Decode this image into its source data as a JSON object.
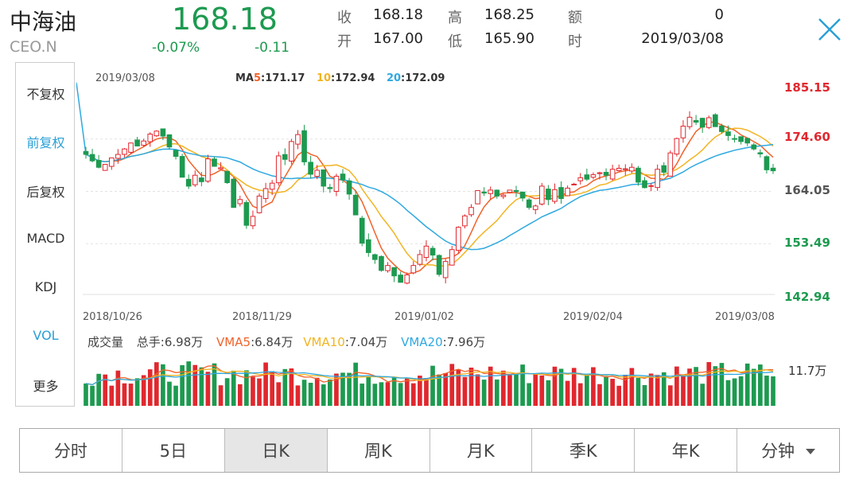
{
  "header": {
    "name": "中海油",
    "code": "CEO.N",
    "price": "168.18",
    "change_pct": "-0.07%",
    "change": "-0.11",
    "quote": [
      {
        "label": "收",
        "value": "168.18"
      },
      {
        "label": "开",
        "value": "167.00"
      },
      {
        "label": "高",
        "value": "168.25"
      },
      {
        "label": "低",
        "value": "165.90"
      },
      {
        "label": "额",
        "value": "0"
      },
      {
        "label": "时",
        "value": "2019/03/08"
      }
    ]
  },
  "left_panel": {
    "items": [
      "不复权",
      "前复权",
      "后复权",
      "MACD",
      "KDJ",
      "VOL",
      "更多"
    ]
  },
  "chart": {
    "top_date": "2019/03/08",
    "ma_label": "MA",
    "ma5_key": "5",
    "ma5_value": ":171.17",
    "ma10_key": "10",
    "ma10_value": ":172.94",
    "ma20_key": "20",
    "ma20_value": ":172.09",
    "y_labels": [
      "185.15",
      "174.60",
      "164.05",
      "153.49",
      "142.94"
    ],
    "x_labels": [
      "2018/10/26",
      "2018/11/29",
      "2019/01/02",
      "2019/02/04",
      "2019/03/08"
    ],
    "vol_title": "成交量",
    "vol_total_label": "总手:",
    "vol_total_value": "6.98万",
    "vma5_label": "VMA5",
    "vma5_value": ":6.84万",
    "vma10_label": "VMA10",
    "vma10_value": ":7.04万",
    "vma20_label": "VMA20",
    "vma20_value": ":7.96万",
    "vol_axis_label": "11.7万"
  },
  "tabs": [
    "分时",
    "5日",
    "日K",
    "周K",
    "月K",
    "季K",
    "年K",
    "分钟"
  ],
  "colors": {
    "up": "#e0282e",
    "down": "#1d9a50",
    "ma5": "#f0622a",
    "ma10": "#f2b422",
    "ma20": "#2fa9e0",
    "accent": "#2a9fd6"
  },
  "chart_data": {
    "type": "candlestick",
    "y_range": [
      142.94,
      185.15
    ],
    "closes": [
      171.5,
      170.2,
      168.9,
      169.5,
      170.8,
      171.5,
      172.6,
      173.8,
      173.2,
      174.2,
      175.6,
      176.2,
      175.2,
      173.0,
      171.1,
      166.9,
      165.1,
      167.3,
      166.0,
      170.6,
      169.1,
      168.8,
      165.8,
      160.8,
      162.4,
      157.2,
      159.0,
      163.1,
      164.6,
      165.7,
      171.2,
      170.5,
      174.1,
      175.5,
      170.0,
      167.5,
      168.3,
      165.1,
      164.6,
      167.1,
      166.4,
      163.5,
      159.3,
      153.6,
      151.7,
      150.3,
      148.1,
      149.1,
      147.0,
      145.7,
      147.2,
      149.1,
      151.3,
      153.0,
      151.2,
      147.3,
      149.9,
      152.3,
      156.8,
      159.1,
      160.8,
      164.2,
      163.7,
      164.3,
      163.1,
      163.3,
      164.3,
      164.0,
      162.7,
      160.8,
      161.1,
      165.1,
      162.4,
      164.4,
      162.6,
      164.7,
      165.5,
      166.8,
      166.5,
      167.4,
      167.8,
      167.3,
      168.5,
      168.7,
      168.6,
      168.9,
      165.9,
      164.8,
      165.2,
      168.5,
      167.9,
      171.8,
      174.7,
      177.2,
      179.0,
      178.0,
      177.0,
      178.9,
      177.1,
      176.1,
      175.3,
      174.6,
      174.1,
      173.8,
      172.6,
      171.6,
      168.4,
      168.2
    ]
  }
}
